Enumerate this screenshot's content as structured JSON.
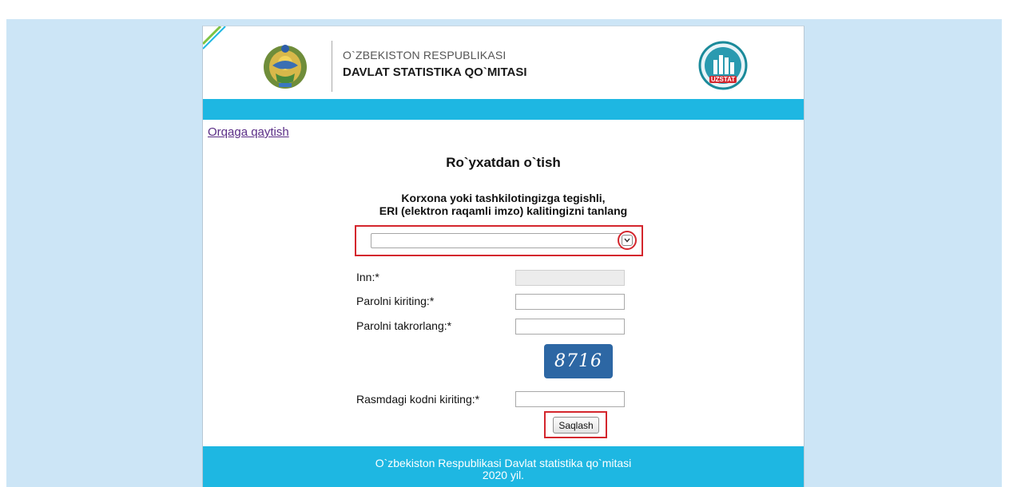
{
  "header": {
    "org_line1": "O`ZBEKISTON RESPUBLIKASI",
    "org_line2": "DAVLAT STATISTIKA QO`MITASI",
    "logo_label": "UZSTAT",
    "emblem_icon": "uzbekistan-emblem-icon",
    "logo_icon": "uzstat-logo-icon",
    "accent_color": "#1eb7e2"
  },
  "nav": {
    "back_link": "Orqaga qaytish"
  },
  "form": {
    "title": "Ro`yxatdan o`tish",
    "subtitle_line1": "Korxona yoki tashkilotingizga tegishli,",
    "subtitle_line2": "ERI (elektron raqamli imzo) kalitingizni tanlang",
    "key_select_value": "",
    "inn_label": "Inn:*",
    "inn_value": "",
    "password_label": "Parolni kiriting:*",
    "password_value": "",
    "password_repeat_label": "Parolni takrorlang:*",
    "password_repeat_value": "",
    "captcha_text": "8716",
    "captcha_label": "Rasmdagi kodni kiriting:*",
    "captcha_value": "",
    "save_label": "Saqlash",
    "highlight_color": "#d4262d"
  },
  "footer": {
    "line1": "O`zbekiston Respublikasi Davlat statistika qo`mitasi",
    "line2": "2020 yil."
  }
}
